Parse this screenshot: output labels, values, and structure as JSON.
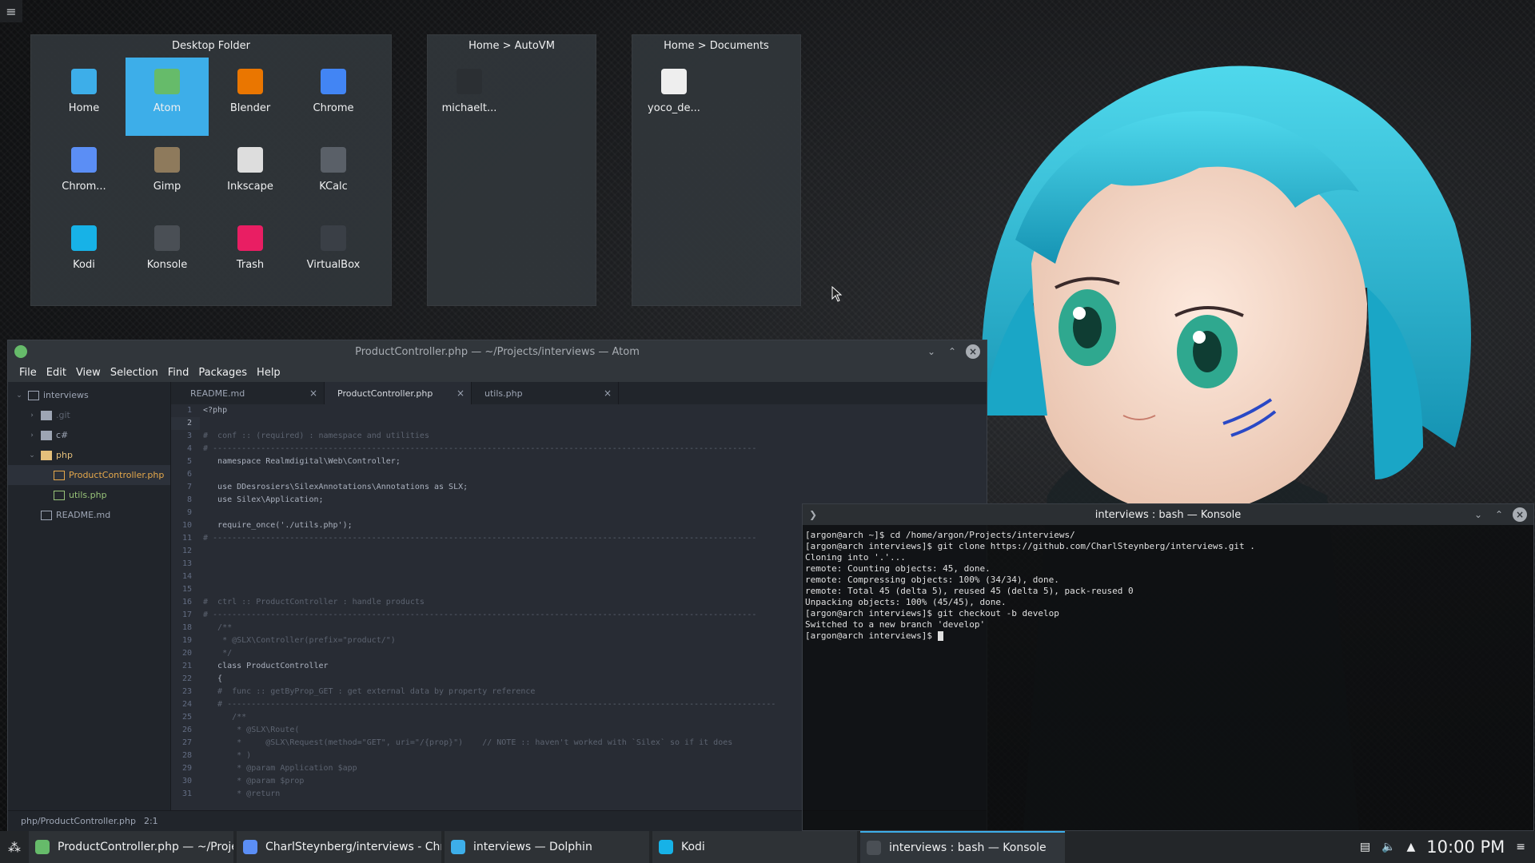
{
  "desktop": {
    "widgets": [
      {
        "title": "Desktop Folder",
        "items": [
          {
            "label": "Home",
            "icon": "home-folder-icon",
            "color": "#3daee9"
          },
          {
            "label": "Atom",
            "icon": "atom-icon",
            "color": "#66bb6a",
            "selected": true
          },
          {
            "label": "Blender",
            "icon": "blender-icon",
            "color": "#ea7600"
          },
          {
            "label": "Chrome",
            "icon": "chrome-icon",
            "color": "#4285f4"
          },
          {
            "label": "Chrom...",
            "icon": "chromium-icon",
            "color": "#5b8ef5"
          },
          {
            "label": "Gimp",
            "icon": "gimp-icon",
            "color": "#8e7a5c"
          },
          {
            "label": "Inkscape",
            "icon": "inkscape-icon",
            "color": "#dddddd"
          },
          {
            "label": "KCalc",
            "icon": "kcalc-icon",
            "color": "#5a6068"
          },
          {
            "label": "Kodi",
            "icon": "kodi-icon",
            "color": "#17b2e7"
          },
          {
            "label": "Konsole",
            "icon": "konsole-icon",
            "color": "#4a4f55"
          },
          {
            "label": "Trash",
            "icon": "trash-icon",
            "color": "#e91e63"
          },
          {
            "label": "VirtualBox",
            "icon": "virtualbox-icon",
            "color": "#3a3f46"
          }
        ]
      },
      {
        "title": "Home > AutoVM",
        "items": [
          {
            "label": "michaelt...",
            "icon": "terminal-script-icon",
            "color": "#2b2f33"
          }
        ]
      },
      {
        "title": "Home > Documents",
        "items": [
          {
            "label": "yoco_de...",
            "icon": "document-icon",
            "color": "#eeeeee"
          }
        ]
      }
    ]
  },
  "atom": {
    "title": "ProductController.php — ~/Projects/interviews — Atom",
    "menu": [
      "File",
      "Edit",
      "View",
      "Selection",
      "Find",
      "Packages",
      "Help"
    ],
    "tree": [
      {
        "label": "interviews",
        "depth": 0,
        "kind": "project",
        "open": true
      },
      {
        "label": ".git",
        "depth": 1,
        "kind": "folder",
        "dim": true
      },
      {
        "label": "c#",
        "depth": 1,
        "kind": "folder"
      },
      {
        "label": "php",
        "depth": 1,
        "kind": "folder",
        "open": true,
        "accent": "#e5c07b"
      },
      {
        "label": "ProductController.php",
        "depth": 2,
        "kind": "file",
        "accent": "#e5a84b",
        "selected": true
      },
      {
        "label": "utils.php",
        "depth": 2,
        "kind": "file",
        "accent": "#98c379"
      },
      {
        "label": "README.md",
        "depth": 1,
        "kind": "book"
      }
    ],
    "tabs": [
      {
        "label": "README.md",
        "active": false
      },
      {
        "label": "ProductController.php",
        "active": true
      },
      {
        "label": "utils.php",
        "active": false
      }
    ],
    "code": [
      "<?php",
      "",
      "#  conf :: (required) : namespace and utilities",
      "# -----------------------------------------------------------------------------------------------------------------",
      "   namespace Realmdigital\\Web\\Controller;",
      "",
      "   use DDesrosiers\\SilexAnnotations\\Annotations as SLX;",
      "   use Silex\\Application;",
      "",
      "   require_once('./utils.php');",
      "# -----------------------------------------------------------------------------------------------------------------",
      "",
      "",
      "",
      "",
      "#  ctrl :: ProductController : handle products",
      "# -----------------------------------------------------------------------------------------------------------------",
      "   /**",
      "    * @SLX\\Controller(prefix=\"product/\")",
      "    */",
      "   class ProductController",
      "   {",
      "   #  func :: getByProp_GET : get external data by property reference",
      "   # ------------------------------------------------------------------------------------------------------------------",
      "      /**",
      "       * @SLX\\Route(",
      "       *     @SLX\\Request(method=\"GET\", uri=\"/{prop}\")    // NOTE :: haven't worked with `Silex` so if it does",
      "       * )",
      "       * @param Application $app",
      "       * @param $prop",
      "       * @return"
    ],
    "status": {
      "path": "php/ProductController.php",
      "cursor": "2:1"
    }
  },
  "konsole": {
    "title": "interviews : bash — Konsole",
    "lines": [
      "[argon@arch ~]$ cd /home/argon/Projects/interviews/",
      "[argon@arch interviews]$ git clone https://github.com/CharlSteynberg/interviews.git .",
      "Cloning into '.'...",
      "remote: Counting objects: 45, done.",
      "remote: Compressing objects: 100% (34/34), done.",
      "remote: Total 45 (delta 5), reused 45 (delta 5), pack-reused 0",
      "Unpacking objects: 100% (45/45), done.",
      "[argon@arch interviews]$ git checkout -b develop",
      "Switched to a new branch 'develop'",
      "[argon@arch interviews]$ "
    ]
  },
  "taskbar": {
    "tasks": [
      {
        "label": "ProductController.php — ~/Projec...",
        "icon": "atom-icon",
        "color": "#66bb6a"
      },
      {
        "label": "CharlSteynberg/interviews - Chro...",
        "icon": "chromium-icon",
        "color": "#5b8ef5"
      },
      {
        "label": "interviews — Dolphin",
        "icon": "dolphin-icon",
        "color": "#3daee9"
      },
      {
        "label": "Kodi",
        "icon": "kodi-icon",
        "color": "#17b2e7"
      },
      {
        "label": "interviews : bash — Konsole",
        "icon": "konsole-icon",
        "color": "#4a4f55",
        "active": true
      }
    ],
    "clock": "10:00 PM"
  }
}
